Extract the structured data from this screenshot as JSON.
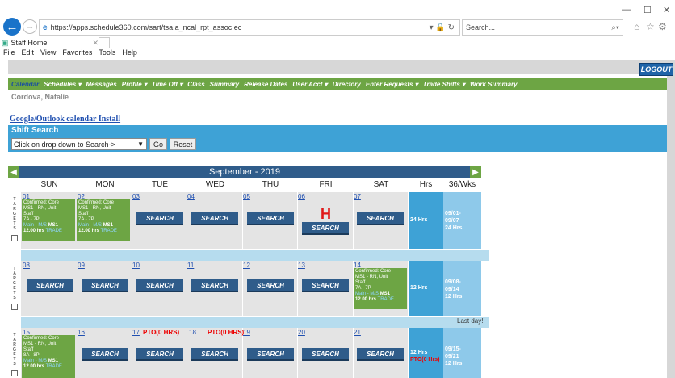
{
  "browser": {
    "url": "https://apps.schedule360.com/sart/tsa.a_ncal_rpt_assoc.ec",
    "search_placeholder": "Search...",
    "tab_title": "Staff Home",
    "menu": [
      "File",
      "Edit",
      "View",
      "Favorites",
      "Tools",
      "Help"
    ]
  },
  "header": {
    "logout_label": "LOGOUT"
  },
  "nav": {
    "items": [
      "Calendar",
      "Schedules ▾",
      "Messages",
      "Profile ▾",
      "Time Off ▾",
      "Class",
      "Summary",
      "Release Dates",
      "User Acct ▾",
      "Directory",
      "Enter Requests ▾",
      "Trade Shifts ▾",
      "Work Summary"
    ]
  },
  "user_name": "Cordova, Natalie",
  "google_link": "Google/Outlook calendar Install",
  "shift_search": {
    "title": "Shift Search",
    "select_value": "Click on drop down to Search->",
    "go_label": "Go",
    "reset_label": "Reset"
  },
  "calendar": {
    "month_title": "September - 2019",
    "days": [
      "SUN",
      "MON",
      "TUE",
      "WED",
      "THU",
      "FRI",
      "SAT"
    ],
    "hrs_label": "Hrs",
    "wks_label": "36/Wks",
    "side_label": "TARGETS",
    "search_label": "SEARCH",
    "holiday_mark": "H",
    "last_day": "Last day!",
    "pto_label": "PTO(0 HRS)",
    "weeks": [
      {
        "dates": [
          "01",
          "02",
          "03",
          "04",
          "05",
          "06",
          "07"
        ],
        "hrs": "24 Hrs",
        "wk_range": [
          "09/01-",
          "09/07",
          "24 Hrs"
        ]
      },
      {
        "dates": [
          "08",
          "09",
          "10",
          "11",
          "12",
          "13",
          "14"
        ],
        "hrs": "12 Hrs",
        "wk_range": [
          "09/08-",
          "09/14",
          "12 Hrs"
        ]
      },
      {
        "dates": [
          "15",
          "16",
          "17",
          "18",
          "19",
          "20",
          "21"
        ],
        "hrs": "12 Hrs",
        "hrs_pto": "PTO(0 Hrs)",
        "wk_range": [
          "09/15-",
          "09/21",
          "12 Hrs"
        ]
      }
    ],
    "shift_a": {
      "line1": "Confirmed: Core",
      "line2": "MS1 - RN, Unit",
      "line3": "Staff",
      "time": "7A - 7P",
      "link": "Main - M/S",
      "unit": "MS1",
      "hours": "12.00 hrs",
      "trade": "TRADE"
    },
    "shift_b": {
      "line1": "Confirmed: Core",
      "line2": "MS1 - RN, Unit",
      "line3": "Staff",
      "time": "8A - 8P",
      "link": "Main - M/S",
      "unit": "MS1",
      "hours": "12.00 hrs",
      "trade": "TRADE"
    }
  }
}
